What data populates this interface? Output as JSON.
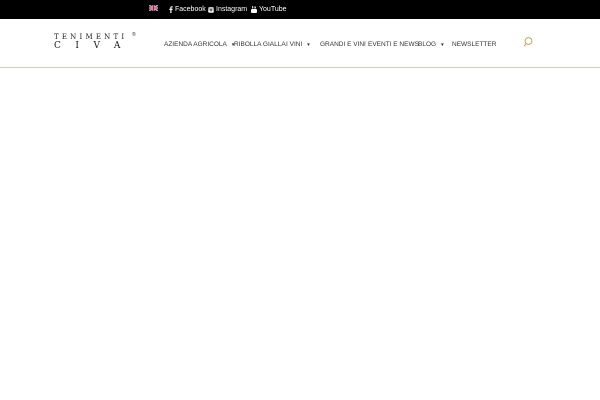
{
  "colors": {
    "topbar_bg": "#000000",
    "accent_line": "#dcc9b0",
    "search_icon": "#c8a25a",
    "nav_text": "#333333"
  },
  "topbar": {
    "language_icon": "uk-flag-icon",
    "facebook": "Facebook",
    "instagram": "Instagram",
    "youtube": "YouTube"
  },
  "logo": {
    "line1": "TENIMENTI",
    "line2": "CIVA",
    "mark": "®"
  },
  "nav": {
    "items": [
      {
        "label": "AZIENDA AGRICOLA",
        "has_submenu": true
      },
      {
        "label": "RIBOLLA GIALLA",
        "has_submenu": false
      },
      {
        "label": "I VINI",
        "has_submenu": true
      },
      {
        "label": "GRANDI E VINI",
        "has_submenu": false
      },
      {
        "label": "EVENTI E NEWS",
        "has_submenu": false
      },
      {
        "label": "BLOG",
        "has_submenu": true
      },
      {
        "label": "NEWSLETTER",
        "has_submenu": false
      }
    ],
    "submenu_icon": "caret-down-icon"
  },
  "search_icon": "search-icon"
}
